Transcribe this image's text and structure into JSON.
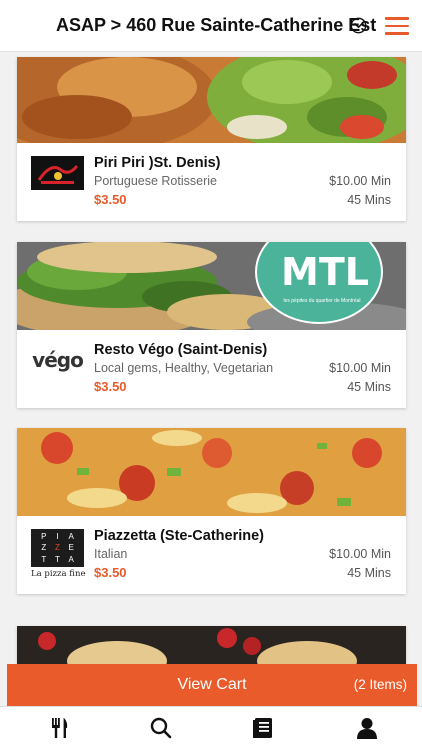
{
  "header": {
    "address": "ASAP > 460 Rue Sainte-Catherine Est",
    "chevron_icon": "chevron-down-circle-icon",
    "menu_icon": "hamburger-menu-icon",
    "accent": "#e85a2c"
  },
  "restaurants": [
    {
      "name": "Piri Piri )St. Denis)",
      "category": "Portuguese Rotisserie",
      "delivery_fee": "$3.50",
      "minimum": "$10.00 Min",
      "time": "45 Mins"
    },
    {
      "name": "Resto Végo (Saint-Denis)",
      "category": "Local gems, Healthy, Vegetarian",
      "delivery_fee": "$3.50",
      "minimum": "$10.00 Min",
      "time": "45 Mins",
      "badge_text": "MTL",
      "badge_subtext": "les pépites du quartier de Montréal",
      "logo_text": "végo"
    },
    {
      "name": "Piazzetta (Ste-Catherine)",
      "category": "Italian",
      "delivery_fee": "$3.50",
      "minimum": "$10.00 Min",
      "time": "45 Mins",
      "logo_letters": [
        "P",
        "I",
        "A",
        "Z",
        "Z",
        "E",
        "T",
        "T",
        "A"
      ],
      "logo_caption": "La pizza fine"
    }
  ],
  "cart": {
    "label": "View Cart",
    "count": "(2 Items)"
  },
  "tabs": [
    {
      "icon": "fork-knife-icon"
    },
    {
      "icon": "search-icon"
    },
    {
      "icon": "orders-list-icon"
    },
    {
      "icon": "user-profile-icon"
    }
  ]
}
